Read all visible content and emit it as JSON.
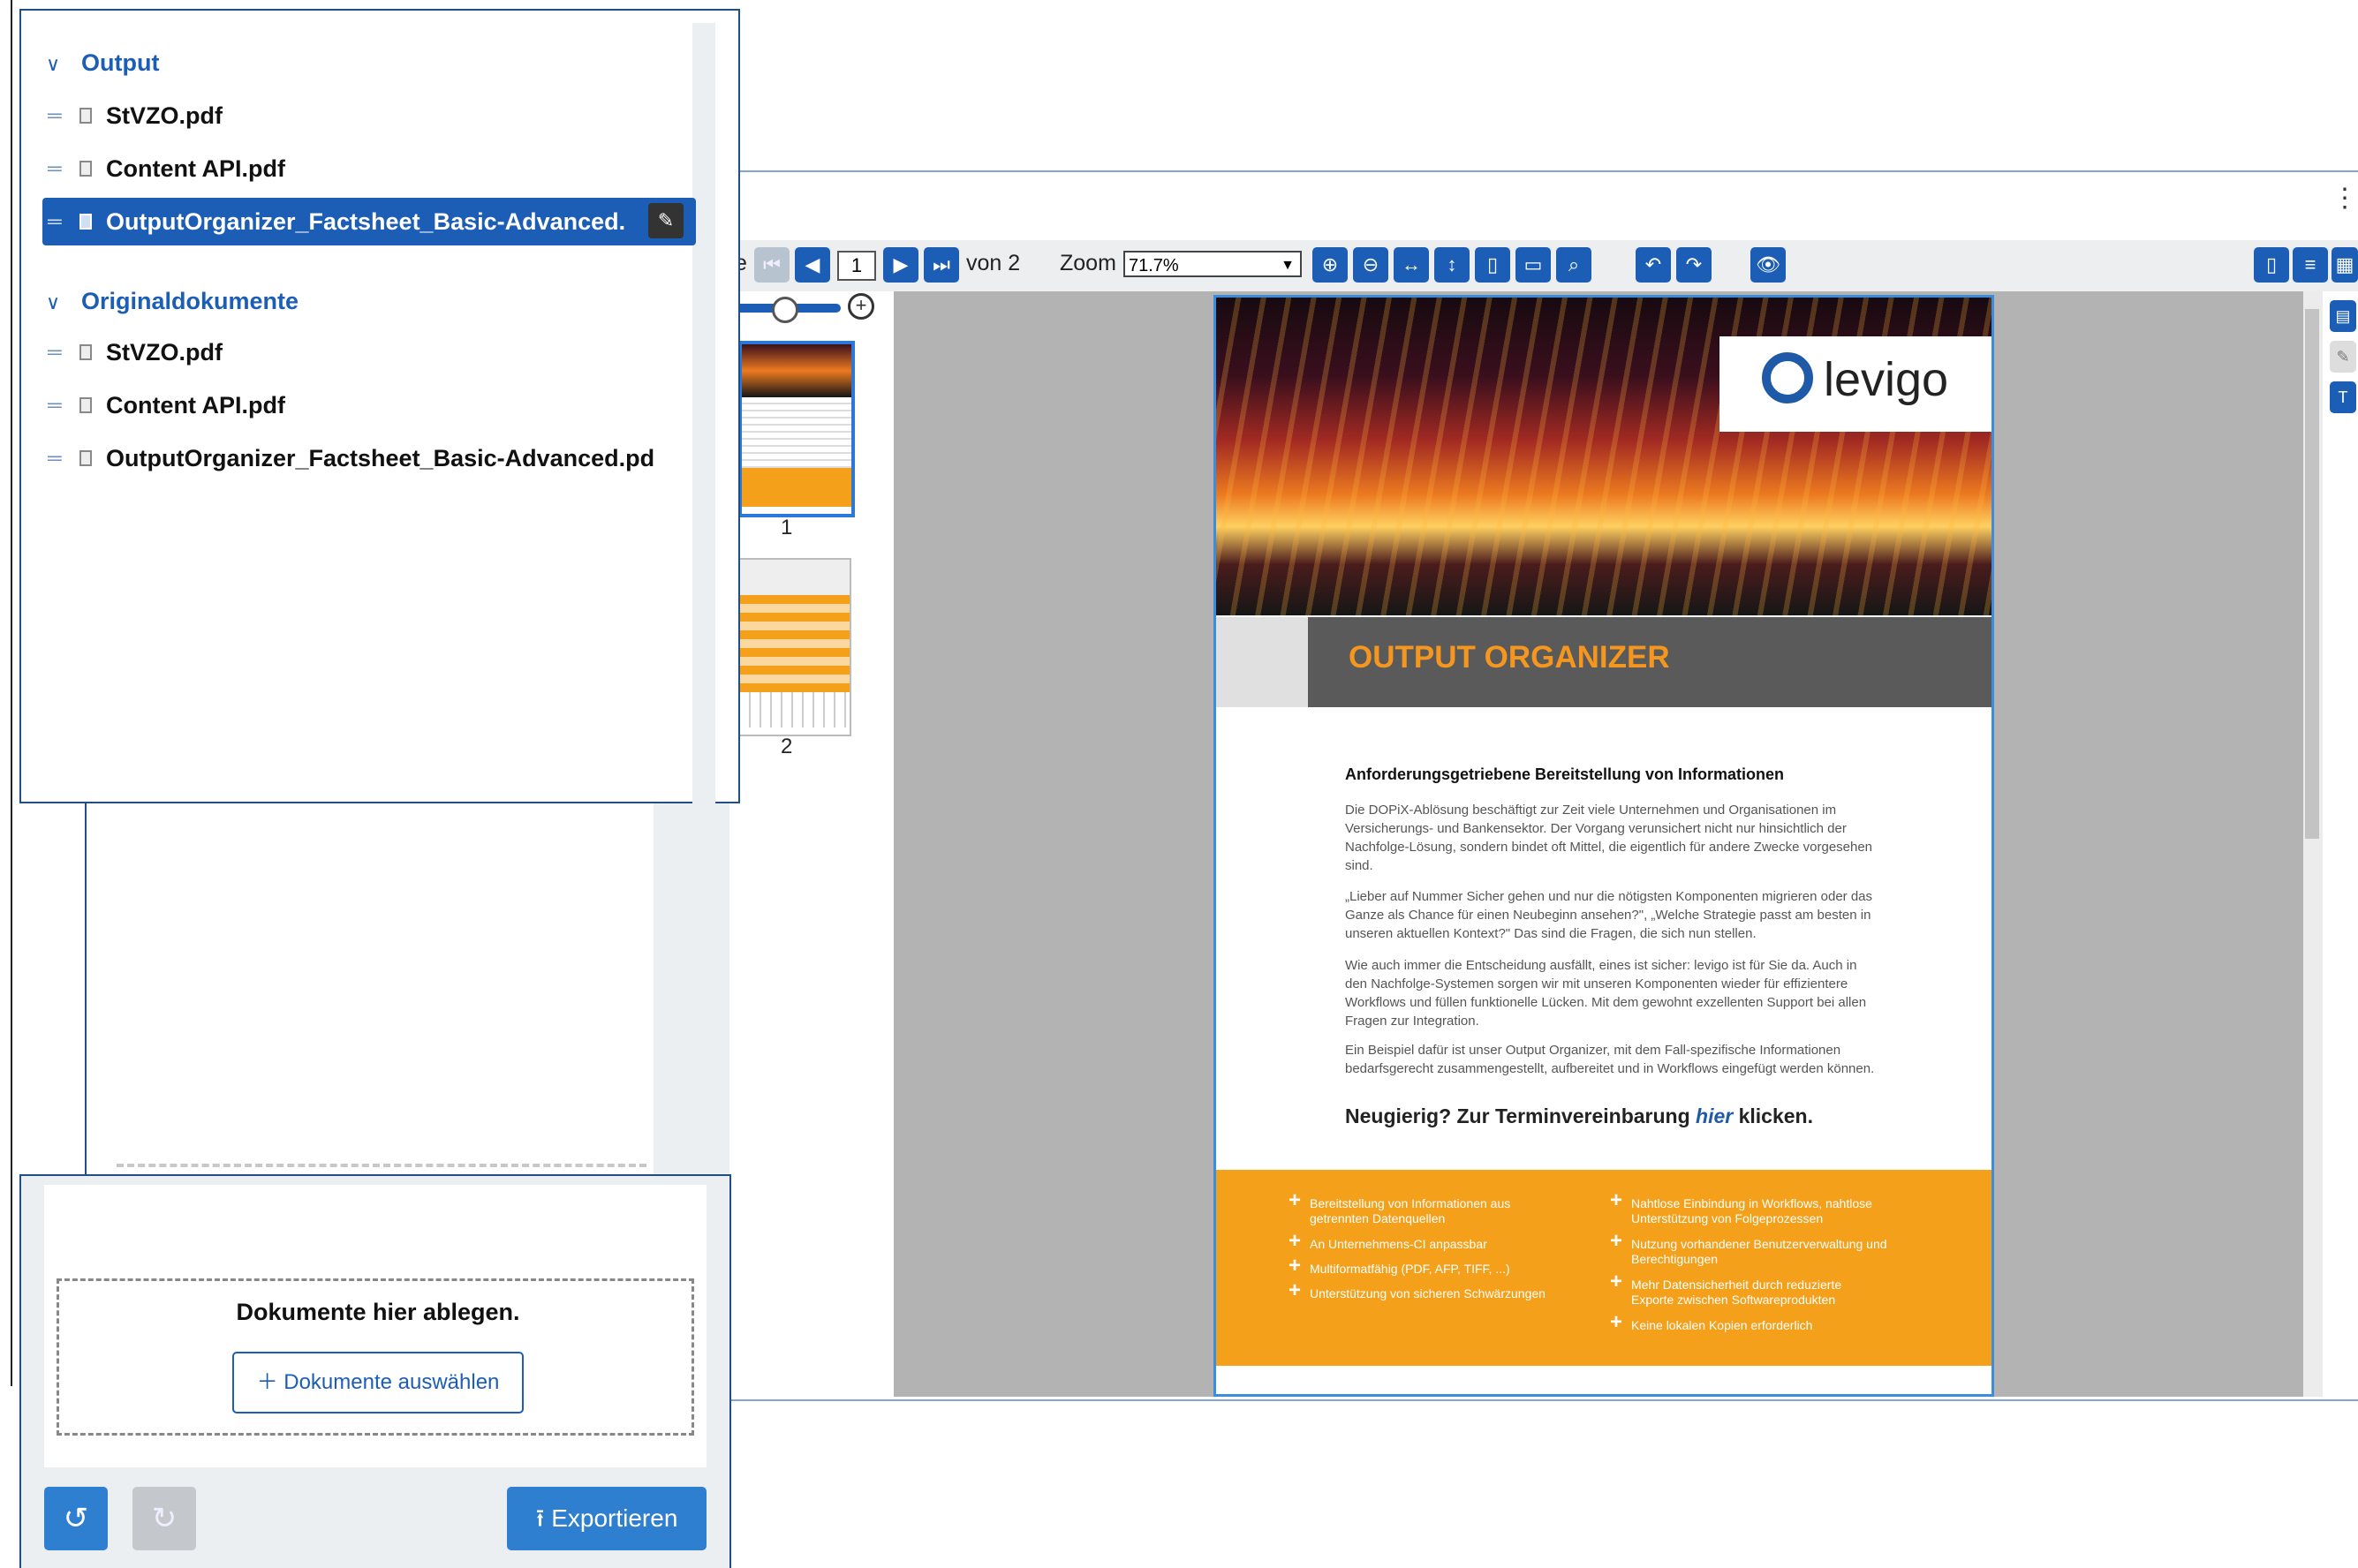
{
  "viewer": {
    "toolbar": {
      "page_prefix": "e",
      "page_input": "1",
      "of_pages": "von 2",
      "zoom_label": "Zoom",
      "zoom_value": "71.7%"
    },
    "thumbnails": [
      "1",
      "2"
    ]
  },
  "document": {
    "logo_text": "levigo",
    "title": "OUTPUT ORGANIZER",
    "heading": "Anforderungsgetriebene Bereitstellung von Informationen",
    "paragraphs": [
      "Die DOPiX-Ablösung beschäftigt zur Zeit viele Unternehmen und Organisationen im Versicherungs- und Bankensektor. Der Vorgang verunsichert nicht nur hinsichtlich der Nachfolge-Lösung, sondern bindet oft Mittel, die eigentlich für andere Zwecke vorgesehen sind.",
      "„Lieber auf Nummer Sicher gehen und nur die nötigsten Komponenten migrieren oder das Ganze als Chance für einen Neubeginn ansehen?\", „Welche Strategie passt am besten in unseren aktuellen Kontext?\" Das sind die Fragen, die sich nun stellen.",
      "Wie auch immer die Entscheidung ausfällt, eines ist sicher: levigo ist für Sie da. Auch in den Nachfolge-Systemen sorgen wir mit unseren Komponenten wieder für effizientere Workflows und füllen funktionelle Lücken. Mit dem gewohnt exzellenten Support bei allen Fragen zur Integration.",
      "Ein Beispiel dafür ist unser Output Organizer, mit dem Fall-spezifische Informationen bedarfsgerecht zusammengestellt, aufbereitet und in Workflows eingefügt werden können."
    ],
    "cta_prefix": "Neugierig? Zur Terminvereinbarung ",
    "cta_link": "hier",
    "cta_suffix": " klicken.",
    "bullets_left": [
      "Bereitstellung von Informationen aus getrennten Datenquellen",
      "An Unternehmens-CI anpassbar",
      "Multiformatfähig (PDF, AFP, TIFF, ...)",
      "Unterstützung von sicheren Schwärzungen"
    ],
    "bullets_right": [
      "Nahtlose Einbindung in Workflows, nahtlose Unterstützung von Folgeprozessen",
      "Nutzung vorhandener Benutzerverwaltung und Berechtigungen",
      "Mehr Datensicherheit durch reduzierte Exporte zwischen Softwareprodukten",
      "Keine lokalen Kopien erforderlich"
    ]
  },
  "organizer": {
    "output_section": {
      "label": "Output",
      "items": [
        "StVZO.pdf",
        "Content API.pdf",
        "OutputOrganizer_Factsheet_Basic-Advanced."
      ]
    },
    "original_section": {
      "label": "Originaldokumente",
      "items": [
        "StVZO.pdf",
        "Content API.pdf",
        "OutputOrganizer_Factsheet_Basic-Advanced.pd"
      ]
    },
    "drop_title": "Dokumente hier ablegen.",
    "select_button": "Dokumente auswählen",
    "export_button": "Exportieren"
  },
  "colors": {
    "accent": "#1c5eb5",
    "document_orange": "#f4a01a",
    "title_orange": "#f5961e"
  }
}
